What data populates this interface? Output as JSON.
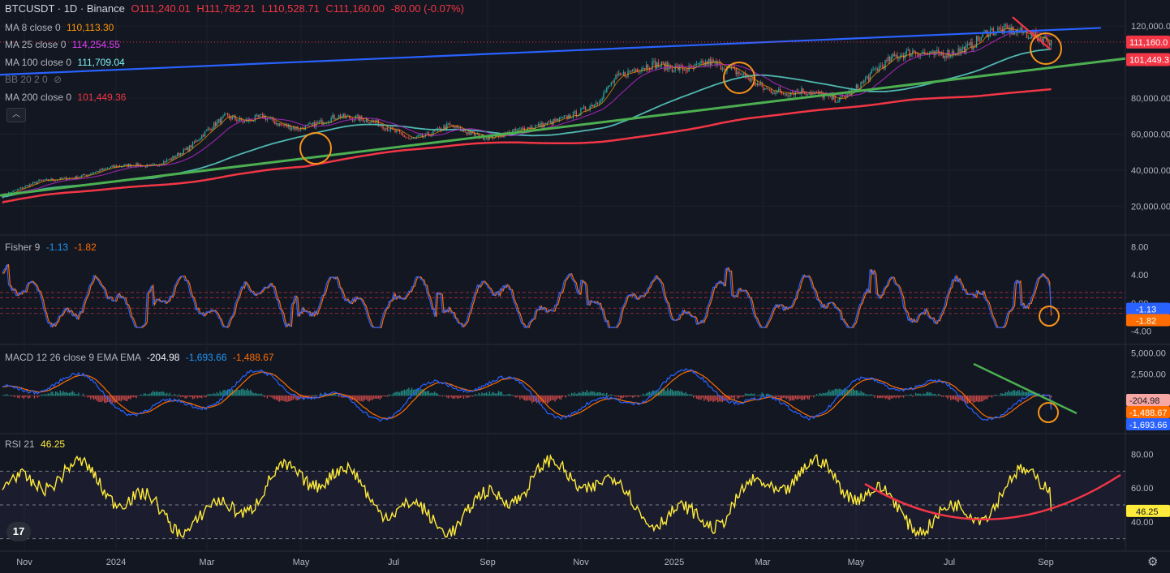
{
  "header": {
    "symbol": "BTCUSDT · 1D · Binance",
    "o": "O111,240.01",
    "h": "H111,782.21",
    "l": "L110,528.71",
    "c": "C111,160.00",
    "chg": "-80.00 (-0.07%)"
  },
  "indicators": [
    {
      "label": "MA 8 close 0",
      "value": "110,113.30",
      "color": "#ff9800"
    },
    {
      "label": "MA 25 close 0",
      "value": "114,254.55",
      "color": "#e040fb"
    },
    {
      "label": "MA 100 close 0",
      "value": "111,709.04",
      "color": "#7ef3f3"
    },
    {
      "label": "BB 20 2 0",
      "value": "",
      "color": "#b2b5be"
    },
    {
      "label": "MA 200 close 0",
      "value": "101,449.36",
      "color": "#f23645"
    }
  ],
  "fisher_legend": {
    "label": "Fisher 9",
    "v1": "-1.13",
    "v2": "-1.82"
  },
  "macd_legend": {
    "label": "MACD 12 26 close 9 EMA EMA",
    "v1": "-204.98",
    "v2": "-1,693.66",
    "v3": "-1,488.67"
  },
  "rsi_legend": {
    "label": "RSI 21",
    "v1": "46.25"
  },
  "colors": {
    "bg": "#131722",
    "up": "#26a69a",
    "down": "#ef5350",
    "ma8": "#ff9800",
    "ma25": "#9c27b0",
    "ma100": "#4fb8b0",
    "ma200": "#f23645",
    "support": "#4caf50",
    "resistance": "#2962ff",
    "circle": "#f7931a",
    "rsi": "#ffeb3b"
  },
  "chart_data": [
    {
      "type": "candlestick",
      "pane": "price",
      "y_ticks": [
        "120,000.00",
        "100,000.00",
        "80,000.00",
        "60,000.00",
        "40,000.00",
        "20,000.00"
      ],
      "y_tick_values": [
        120000,
        100000,
        80000,
        60000,
        40000,
        20000
      ],
      "ylim": [
        13000,
        130000
      ],
      "price_labels": [
        {
          "text": "111,160.0",
          "value": 111160,
          "color": "#f23645"
        },
        {
          "text": "101,449.3",
          "value": 101449,
          "color": "#f23645"
        }
      ],
      "x_ticks": [
        "Nov",
        "2024",
        "Mar",
        "May",
        "Jul",
        "Sep",
        "Nov",
        "2025",
        "Mar",
        "May",
        "Jul",
        "Sep"
      ],
      "close_path": [
        [
          0,
          26000
        ],
        [
          20,
          34000
        ],
        [
          40,
          36000
        ],
        [
          60,
          42000
        ],
        [
          70,
          43000
        ],
        [
          80,
          42000
        ],
        [
          90,
          46000
        ],
        [
          100,
          52000
        ],
        [
          110,
          62000
        ],
        [
          120,
          70000
        ],
        [
          130,
          67000
        ],
        [
          140,
          70000
        ],
        [
          150,
          65000
        ],
        [
          160,
          63000
        ],
        [
          170,
          66000
        ],
        [
          180,
          70000
        ],
        [
          190,
          69000
        ],
        [
          200,
          67000
        ],
        [
          210,
          62000
        ],
        [
          220,
          57000
        ],
        [
          230,
          60000
        ],
        [
          240,
          65000
        ],
        [
          250,
          61000
        ],
        [
          260,
          58000
        ],
        [
          270,
          60000
        ],
        [
          280,
          63000
        ],
        [
          290,
          65000
        ],
        [
          300,
          68000
        ],
        [
          310,
          72000
        ],
        [
          320,
          78000
        ],
        [
          330,
          91000
        ],
        [
          340,
          96000
        ],
        [
          350,
          99000
        ],
        [
          360,
          97000
        ],
        [
          370,
          96000
        ],
        [
          380,
          100000
        ],
        [
          390,
          97000
        ],
        [
          400,
          92000
        ],
        [
          410,
          85000
        ],
        [
          420,
          83000
        ],
        [
          430,
          84000
        ],
        [
          440,
          82000
        ],
        [
          450,
          79000
        ],
        [
          460,
          86000
        ],
        [
          470,
          96000
        ],
        [
          480,
          103000
        ],
        [
          490,
          106000
        ],
        [
          500,
          104000
        ],
        [
          510,
          105000
        ],
        [
          520,
          108000
        ],
        [
          530,
          117000
        ],
        [
          540,
          118000
        ],
        [
          550,
          116000
        ],
        [
          560,
          113000
        ],
        [
          565,
          111160
        ]
      ],
      "annotations": {
        "circles": 4,
        "support_trendline": true,
        "resistance_trendline": true,
        "short_downtrend": true
      }
    },
    {
      "type": "line",
      "pane": "fisher",
      "y_ticks": [
        "8.00",
        "4.00",
        "0.00",
        "-4.00"
      ],
      "y_tick_values": [
        8,
        4,
        0,
        -4
      ],
      "ylim": [
        -5,
        9
      ],
      "value_labels": [
        {
          "text": "-1.13",
          "color": "#2962ff"
        },
        {
          "text": "-1.82",
          "color": "#ff6d00"
        }
      ]
    },
    {
      "type": "bar+line",
      "pane": "macd",
      "y_ticks": [
        "5,000.00",
        "2,500.00"
      ],
      "y_tick_values": [
        5000,
        2500
      ],
      "ylim": [
        -4000,
        5500
      ],
      "value_labels": [
        {
          "text": "-204.98",
          "color": "#f7a7a3"
        },
        {
          "text": "-1,488.67",
          "color": "#ff6d00"
        },
        {
          "text": "-1,693.66",
          "color": "#2962ff"
        }
      ]
    },
    {
      "type": "line",
      "pane": "rsi",
      "y_ticks": [
        "80.00",
        "60.00",
        "40.00"
      ],
      "y_tick_values": [
        80,
        60,
        40
      ],
      "ylim": [
        25,
        88
      ],
      "levels": [
        70,
        50,
        30
      ],
      "value_labels": [
        {
          "text": "46.25",
          "color": "#ffeb3b"
        }
      ]
    }
  ]
}
